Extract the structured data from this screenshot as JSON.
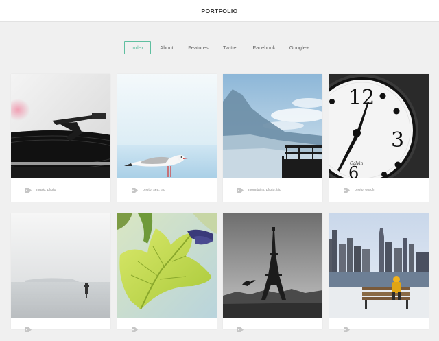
{
  "site": {
    "title": "PORTFOLIO"
  },
  "nav": {
    "items": [
      {
        "label": "Index"
      },
      {
        "label": "About"
      },
      {
        "label": "Features"
      },
      {
        "label": "Twitter"
      },
      {
        "label": "Facebook"
      },
      {
        "label": "Google+"
      }
    ],
    "active": "Index",
    "accent_color": "#5fbfa0"
  },
  "grid": {
    "cards": [
      {
        "image": "turntable",
        "tags": "music, photo",
        "icon": "tag-icon"
      },
      {
        "image": "seagull",
        "tags": "photo, sea, trip",
        "icon": "tag-icon"
      },
      {
        "image": "mountains",
        "tags": "mountains, photo, trip",
        "icon": "tag-icon"
      },
      {
        "image": "watch",
        "tags": "photo, watch",
        "icon": "tag-icon"
      },
      {
        "image": "foggy-sea",
        "tags": "",
        "icon": "tag-icon"
      },
      {
        "image": "green-leaf",
        "tags": "",
        "icon": "tag-icon"
      },
      {
        "image": "eiffel-tower",
        "tags": "",
        "icon": "tag-icon"
      },
      {
        "image": "city-bench",
        "tags": "",
        "icon": "tag-icon"
      }
    ]
  }
}
